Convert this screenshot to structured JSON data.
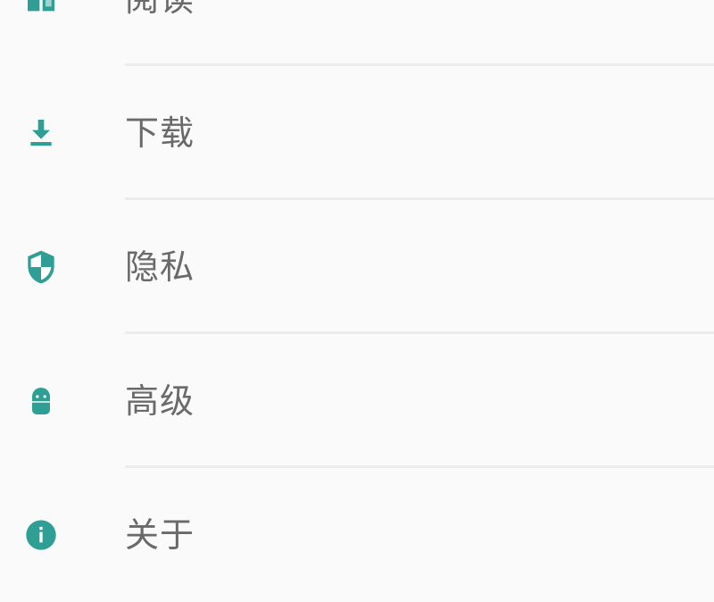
{
  "accent_color": "#2f9e94",
  "settings": {
    "items": [
      {
        "icon": "book-icon",
        "label": "阅读"
      },
      {
        "icon": "download-icon",
        "label": "下载"
      },
      {
        "icon": "shield-icon",
        "label": "隐私"
      },
      {
        "icon": "android-icon",
        "label": "高级"
      },
      {
        "icon": "info-icon",
        "label": "关于"
      }
    ]
  }
}
